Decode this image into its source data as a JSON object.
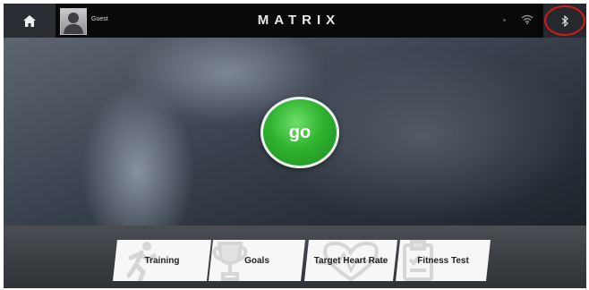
{
  "topbar": {
    "user_name": "Guest",
    "brand": "MATRIX",
    "icons": [
      "home-icon",
      "avatar",
      "wifi-icon",
      "bluetooth-icon"
    ],
    "highlight_color": "#d21b1b"
  },
  "main": {
    "go_label": "go",
    "go_color": "#2fb32f"
  },
  "bottom": {
    "tiles": [
      {
        "label": "Training",
        "icon": "runner-icon"
      },
      {
        "label": "Goals",
        "icon": "trophy-icon"
      },
      {
        "label": "Target Heart Rate",
        "icon": "heart-icon"
      },
      {
        "label": "Fitness Test",
        "icon": "clipboard-icon"
      }
    ]
  }
}
